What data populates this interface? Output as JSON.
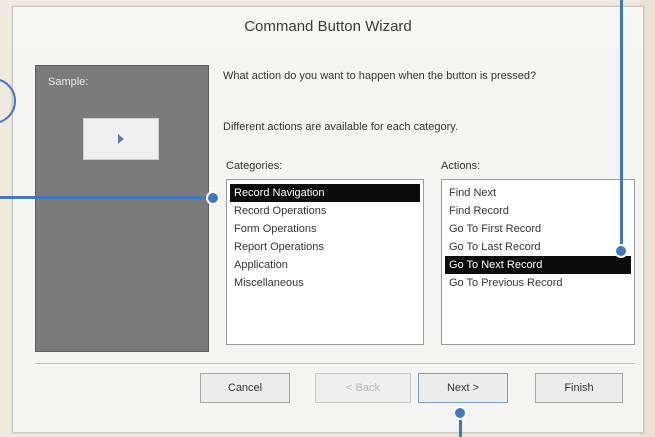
{
  "dialog": {
    "title": "Command Button Wizard"
  },
  "sample": {
    "label": "Sample:"
  },
  "prompt": {
    "question": "What action do you want to happen when the button is pressed?",
    "hint": "Different actions are available for each category."
  },
  "categories": {
    "label": "Categories:",
    "items": [
      "Record Navigation",
      "Record Operations",
      "Form Operations",
      "Report Operations",
      "Application",
      "Miscellaneous"
    ],
    "selected": "Record Navigation"
  },
  "actions": {
    "label": "Actions:",
    "items": [
      "Find Next",
      "Find Record",
      "Go To First Record",
      "Go To Last Record",
      "Go To Next Record",
      "Go To Previous Record"
    ],
    "selected": "Go To Next Record"
  },
  "buttons": {
    "cancel": "Cancel",
    "back": "< Back",
    "next": "Next >",
    "finish": "Finish"
  },
  "colors": {
    "callout": "#3f78be",
    "selection": "#0b0b0b",
    "sample_panel": "#7b7b7b"
  }
}
